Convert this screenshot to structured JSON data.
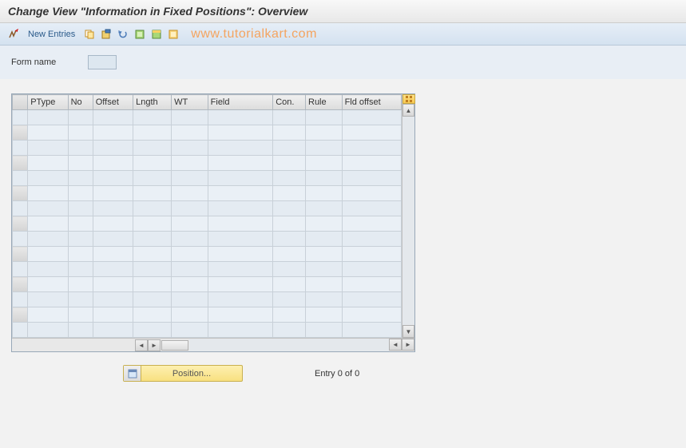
{
  "title": "Change View \"Information in Fixed Positions\": Overview",
  "toolbar": {
    "new_entries": "New Entries"
  },
  "watermark": "www.tutorialkart.com",
  "form": {
    "name_label": "Form name",
    "name_value": ""
  },
  "table": {
    "columns": {
      "ptype": "PType",
      "no": "No",
      "offset": "Offset",
      "lngth": "Lngth",
      "wt": "WT",
      "field": "Field",
      "con": "Con.",
      "rule": "Rule",
      "fldoffset": "Fld offset"
    },
    "rows": []
  },
  "footer": {
    "position_label": "Position...",
    "entry_status": "Entry 0 of 0"
  }
}
